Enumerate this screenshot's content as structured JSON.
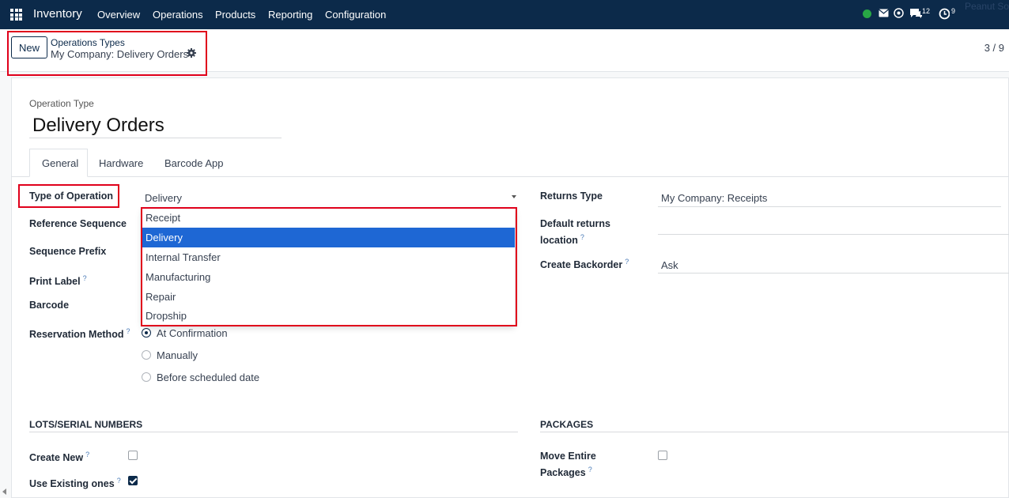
{
  "navbar": {
    "app_name": "Inventory",
    "menu": [
      "Overview",
      "Operations",
      "Products",
      "Reporting",
      "Configuration"
    ],
    "messages_count": "12",
    "activities_count": "9",
    "company_faded": "Peanut So"
  },
  "control_panel": {
    "new_label": "New",
    "breadcrumb_parent": "Operations Types",
    "breadcrumb_current": "My Company: Delivery Orders",
    "pager": "3 / 9"
  },
  "form": {
    "op_type_label": "Operation Type",
    "title": "Delivery Orders",
    "tabs": [
      "General",
      "Hardware",
      "Barcode App"
    ],
    "left_fields": {
      "type_of_operation": "Type of Operation",
      "type_value": "Delivery",
      "reference_sequence": "Reference Sequence",
      "sequence_prefix": "Sequence Prefix",
      "print_label": "Print Label",
      "barcode": "Barcode",
      "reservation_method": "Reservation Method"
    },
    "reservation_options": [
      "At Confirmation",
      "Manually",
      "Before scheduled date"
    ],
    "dropdown_options": [
      "Receipt",
      "Delivery",
      "Internal Transfer",
      "Manufacturing",
      "Repair",
      "Dropship"
    ],
    "right_fields": {
      "returns_type": "Returns Type",
      "returns_type_value": "My Company: Receipts",
      "default_returns_line1": "Default returns",
      "default_returns_line2": "location",
      "create_backorder": "Create Backorder",
      "create_backorder_value": "Ask"
    },
    "lots_section": "LOTS/SERIAL NUMBERS",
    "create_new": "Create New",
    "use_existing": "Use Existing ones",
    "packages_section": "PACKAGES",
    "move_entire_line1": "Move Entire",
    "move_entire_line2": "Packages",
    "help_mark": "?"
  },
  "colors": {
    "navbar": "#0c2a4a",
    "highlight": "#e0001b",
    "selected_option": "#1e67d4",
    "online": "#28a745"
  }
}
